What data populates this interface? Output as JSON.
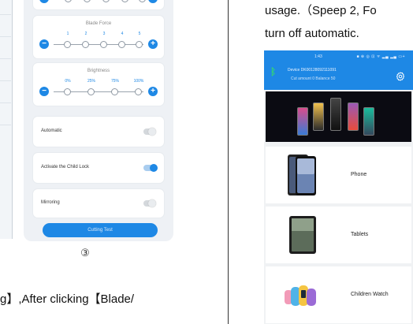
{
  "left_panel": {
    "blade_force": {
      "title": "Blade Force",
      "levels": [
        "1",
        "2",
        "3",
        "4",
        "5"
      ]
    },
    "brightness": {
      "title": "Brightness",
      "levels": [
        "0%",
        "25%",
        "75%",
        "100%"
      ]
    },
    "settings": [
      {
        "label": "Automatic",
        "on": false
      },
      {
        "label": "Activate the Child Lock",
        "on": true
      },
      {
        "label": "Mirroring",
        "on": false
      }
    ],
    "cutting_test_label": "Cutting Test",
    "figure_number": "③",
    "bottom_text": "g】,After clicking【Blade/"
  },
  "right_panel": {
    "text_line_1": "usage.（Speep 2, Fo",
    "text_line_2": "turn off automatic.",
    "status": {
      "time": "1:43",
      "icons_text": "■ ⊕ ◎ ⊡ ᯤ ▂▄ ▂▄ ▭+"
    },
    "device_line": "Device  DK00128092111091",
    "cut_amount_line": "Cut amount   0      Balance     50",
    "products": [
      {
        "name": "Phone",
        "icon": "phone-icon"
      },
      {
        "name": "Tablets",
        "icon": "tablet-icon"
      },
      {
        "name": "Children Watch",
        "icon": "watch-icon"
      }
    ]
  },
  "colors": {
    "accent": "#1e88e5",
    "page": "#eef1f5",
    "bluetooth": "#33d17a"
  }
}
